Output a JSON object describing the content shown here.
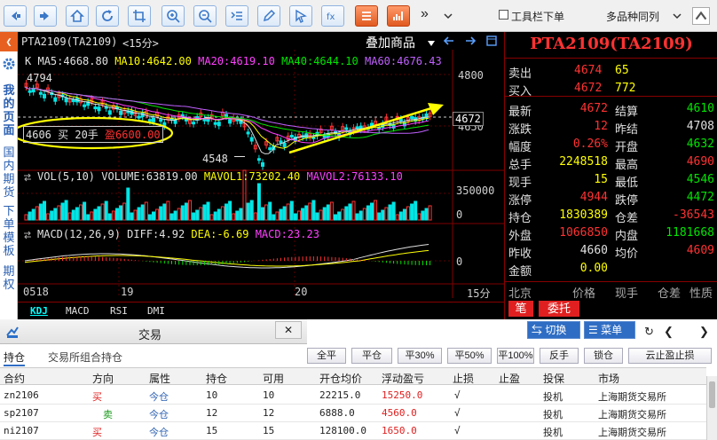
{
  "toolbar": {
    "icons": [
      "back-icon",
      "forward-icon",
      "home-icon",
      "refresh-icon",
      "crop-icon",
      "zoom-in-icon",
      "zoom-out-icon",
      "formula-icon",
      "pen-icon",
      "pointer-icon",
      "fx-icon",
      "list-icon",
      "bar-chart-icon"
    ],
    "more": "»",
    "toolbar_checkbox_label": "工具栏下单",
    "multi_layout": "多品种同列"
  },
  "leftnav": {
    "section1": "我的页面",
    "section2": "国内期货",
    "section3": "下单模板",
    "section4": "期权"
  },
  "chart": {
    "title": "PTA2109(TA2109)",
    "period": "<15分>",
    "overlay_label": "叠加商品",
    "ma_line": {
      "k": "K",
      "ma5": "MA5:4668.80",
      "ma10": "MA10:4642.00",
      "ma20": "MA20:4619.10",
      "ma40": "MA40:4644.10",
      "ma60": "MA60:4676.43"
    },
    "price_ticks": [
      "4800",
      "4650"
    ],
    "high_label": "4794",
    "low_label": "4548",
    "current_price": "4672",
    "position_label": "4606  买  20手",
    "position_profit": "盈6600.00",
    "vol_line": {
      "vol": "VOL(5,10)",
      "volume": "VOLUME:63819.00",
      "mavol1": "MAVOL1:73202.40",
      "mavol2": "MAVOL2:76133.10"
    },
    "vol_ticks": [
      "350000",
      "0"
    ],
    "macd_line": {
      "macd": "MACD(12,26,9)",
      "diff": "DIFF:4.92",
      "dea": "DEA:-6.69",
      "macd_val": "MACD:23.23"
    },
    "macd_ticks": [
      "0"
    ],
    "time_labels": [
      "0518",
      "19",
      "20"
    ],
    "period_short": "15分",
    "indicator_tabs": [
      "KDJ",
      "MACD",
      "RSI",
      "DMI"
    ]
  },
  "quote": {
    "title": "PTA2109(TA2109)",
    "sell": {
      "label": "卖出",
      "price": "4674",
      "qty": "65"
    },
    "buy": {
      "label": "买入",
      "price": "4672",
      "qty": "772"
    },
    "rows": [
      {
        "l1": "最新",
        "v1": "4672",
        "l2": "结算",
        "v2": "4610"
      },
      {
        "l1": "涨跌",
        "v1": "12",
        "l2": "昨结",
        "v2": "4708"
      },
      {
        "l1": "幅度",
        "v1": "0.26%",
        "l2": "开盘",
        "v2": "4632"
      },
      {
        "l1": "总手",
        "v1": "2248518",
        "l2": "最高",
        "v2": "4690"
      },
      {
        "l1": "现手",
        "v1": "15",
        "l2": "最低",
        "v2": "4546"
      },
      {
        "l1": "涨停",
        "v1": "4944",
        "l2": "跌停",
        "v2": "4472"
      },
      {
        "l1": "持仓",
        "v1": "1830389",
        "l2": "仓差",
        "v2": "-36543"
      },
      {
        "l1": "外盘",
        "v1": "1066850",
        "l2": "内盘",
        "v2": "1181668"
      },
      {
        "l1": "昨收",
        "v1": "4660",
        "l2": "均价",
        "v2": "4609"
      },
      {
        "l1": "金额",
        "v1": "0.00",
        "l2": "",
        "v2": ""
      }
    ],
    "tick_header": [
      "北京",
      "价格",
      "现手",
      "仓差",
      "性质"
    ],
    "tabs": [
      "笔",
      "委托"
    ]
  },
  "trade": {
    "title": "交易",
    "close": "✕",
    "switch_label": "切换",
    "menu_label": "菜单",
    "subtabs": [
      "持仓",
      "交易所组合持仓"
    ],
    "buttons": [
      "全平",
      "平仓",
      "平30%",
      "平50%",
      "平100%",
      "反手",
      "锁仓",
      "云止盈止损"
    ],
    "columns": [
      "合约",
      "方向",
      "属性",
      "持仓",
      "可用",
      "开仓均价",
      "浮动盈亏",
      "止损",
      "止盈",
      "投保",
      "市场"
    ],
    "rows": [
      {
        "contract": "zn2106",
        "dir": "买",
        "attr": "今仓",
        "hold": "10",
        "avail": "10",
        "avg": "22215.0",
        "pnl": "15250.0",
        "sl": "√",
        "tp": "",
        "hedge": "投机",
        "market": "上海期货交易所"
      },
      {
        "contract": "sp2107",
        "dir": "卖",
        "attr": "今仓",
        "hold": "12",
        "avail": "12",
        "avg": "6888.0",
        "pnl": "4560.0",
        "sl": "√",
        "tp": "",
        "hedge": "投机",
        "market": "上海期货交易所"
      },
      {
        "contract": "ni2107",
        "dir": "买",
        "attr": "今仓",
        "hold": "15",
        "avail": "15",
        "avg": "128100.0",
        "pnl": "1650.0",
        "sl": "√",
        "tp": "",
        "hedge": "投机",
        "market": "上海期货交易所"
      }
    ]
  },
  "colors": {
    "up": "#ff3232",
    "down": "#00e600",
    "bg": "#000000",
    "accent": "#e02020"
  }
}
